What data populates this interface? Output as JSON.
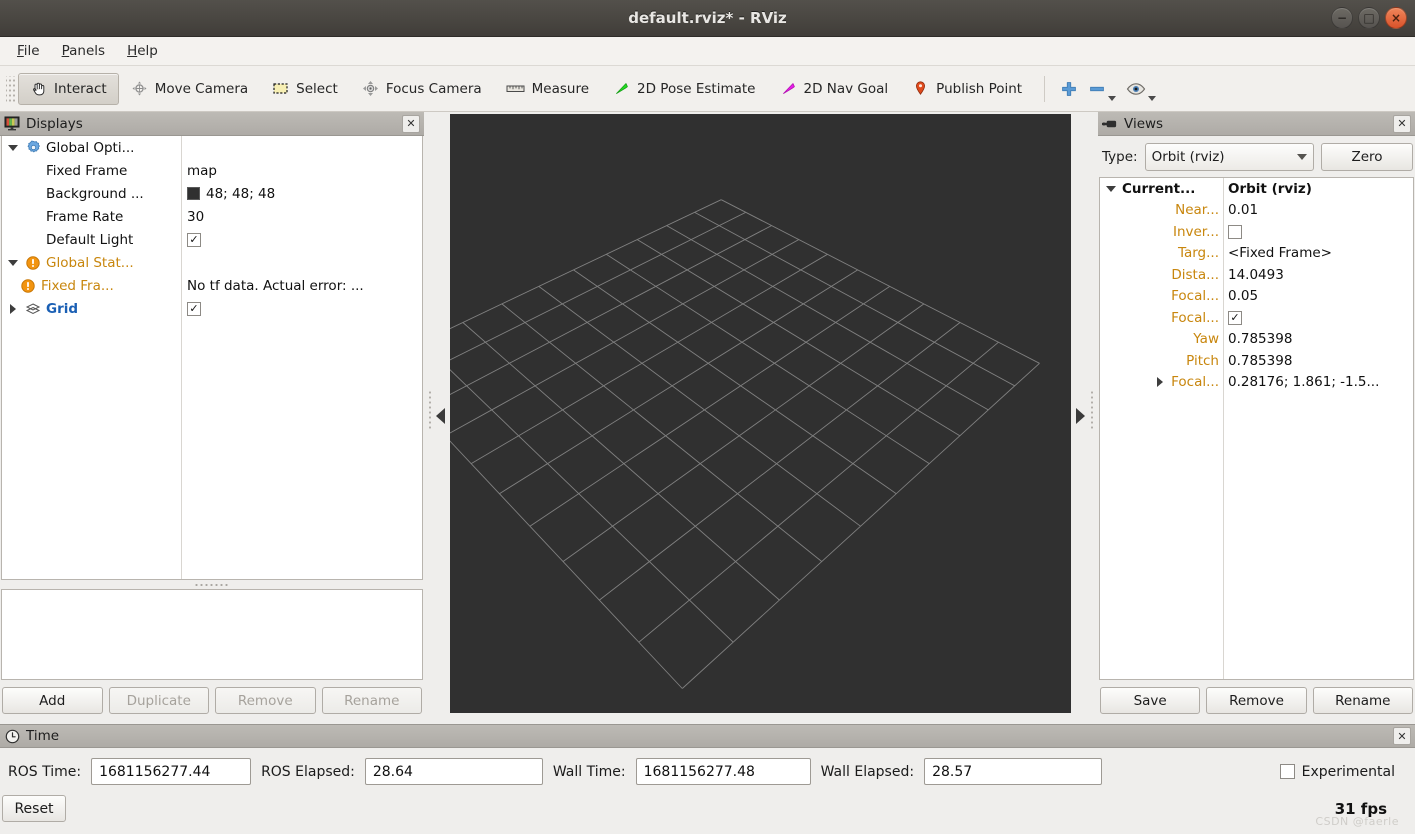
{
  "window": {
    "title": "default.rviz* - RViz",
    "buttons": {
      "minimize": "−",
      "maximize": "□",
      "close": "×"
    }
  },
  "menubar": {
    "items": [
      {
        "label": "File",
        "mnemonic": "F"
      },
      {
        "label": "Panels",
        "mnemonic": "P"
      },
      {
        "label": "Help",
        "mnemonic": "H"
      }
    ]
  },
  "toolbar": {
    "items": [
      {
        "label": "Interact",
        "icon": "hand-icon",
        "active": true
      },
      {
        "label": "Move Camera",
        "icon": "move-camera-icon",
        "active": false
      },
      {
        "label": "Select",
        "icon": "select-rect-icon",
        "active": false
      },
      {
        "label": "Focus Camera",
        "icon": "focus-camera-icon",
        "active": false
      },
      {
        "label": "Measure",
        "icon": "ruler-icon",
        "active": false
      },
      {
        "label": "2D Pose Estimate",
        "icon": "green-arrow-icon",
        "active": false
      },
      {
        "label": "2D Nav Goal",
        "icon": "magenta-arrow-icon",
        "active": false
      },
      {
        "label": "Publish Point",
        "icon": "map-pin-icon",
        "active": false
      }
    ],
    "extras": [
      {
        "icon": "plus-icon"
      },
      {
        "icon": "minus-icon"
      },
      {
        "icon": "eye-icon"
      }
    ]
  },
  "displays": {
    "header": {
      "title": "Displays",
      "icon": "monitor-color-icon",
      "close": "✕"
    },
    "rows": [
      {
        "twisty": "down",
        "icon": "gear-icon",
        "name": "Global Opti...",
        "style": "plain",
        "value_type": "none",
        "value": ""
      },
      {
        "twisty": "none",
        "icon": "none",
        "name": "Fixed Frame",
        "style": "plain",
        "value_type": "text",
        "value": "map",
        "indent": 1
      },
      {
        "twisty": "none",
        "icon": "none",
        "name": "Background ...",
        "style": "plain",
        "value_type": "swatch",
        "value": "48; 48; 48",
        "swatch_color": "#303030",
        "indent": 1
      },
      {
        "twisty": "none",
        "icon": "none",
        "name": "Frame Rate",
        "style": "plain",
        "value_type": "text",
        "value": "30",
        "indent": 1
      },
      {
        "twisty": "none",
        "icon": "none",
        "name": "Default Light",
        "style": "plain",
        "value_type": "checkbox",
        "value": "✓",
        "indent": 1
      },
      {
        "twisty": "down",
        "icon": "warning-icon",
        "name": "Global Stat...",
        "style": "warn",
        "value_type": "none",
        "value": ""
      },
      {
        "twisty": "none",
        "icon": "warning-icon",
        "name": "Fixed Fra...",
        "style": "warn",
        "value_type": "text",
        "value": "No tf data.  Actual error: ...",
        "indent": 1
      },
      {
        "twisty": "right",
        "icon": "grid-icon",
        "name": "Grid",
        "style": "link",
        "value_type": "checkbox",
        "value": "✓"
      }
    ],
    "buttons": [
      {
        "label": "Add",
        "enabled": true
      },
      {
        "label": "Duplicate",
        "enabled": false
      },
      {
        "label": "Remove",
        "enabled": false
      },
      {
        "label": "Rename",
        "enabled": false
      }
    ]
  },
  "views": {
    "header": {
      "title": "Views",
      "icon": "camera-icon",
      "close": "✕"
    },
    "type_label": "Type:",
    "type_value": "Orbit (rviz)",
    "zero_label": "Zero",
    "rows": [
      {
        "twisty": "down",
        "name": "Current...",
        "value": "Orbit (rviz)",
        "root": true,
        "value_type": "text"
      },
      {
        "twisty": "none",
        "name": "Near...",
        "value": "0.01",
        "root": false,
        "value_type": "text"
      },
      {
        "twisty": "none",
        "name": "Inver...",
        "value": "",
        "root": false,
        "value_type": "checkbox_empty"
      },
      {
        "twisty": "none",
        "name": "Targ...",
        "value": "<Fixed Frame>",
        "root": false,
        "value_type": "text"
      },
      {
        "twisty": "none",
        "name": "Dista...",
        "value": "14.0493",
        "root": false,
        "value_type": "text"
      },
      {
        "twisty": "none",
        "name": "Focal...",
        "value": "0.05",
        "root": false,
        "value_type": "text"
      },
      {
        "twisty": "none",
        "name": "Focal...",
        "value": "✓",
        "root": false,
        "value_type": "checkbox"
      },
      {
        "twisty": "none",
        "name": "Yaw",
        "value": "0.785398",
        "root": false,
        "value_type": "text"
      },
      {
        "twisty": "none",
        "name": "Pitch",
        "value": "0.785398",
        "root": false,
        "value_type": "text"
      },
      {
        "twisty": "right",
        "name": "Focal...",
        "value": "0.28176; 1.861; -1.5...",
        "root": false,
        "value_type": "text"
      }
    ],
    "buttons": [
      {
        "label": "Save",
        "enabled": true
      },
      {
        "label": "Remove",
        "enabled": true
      },
      {
        "label": "Rename",
        "enabled": true
      }
    ]
  },
  "time": {
    "header": {
      "title": "Time",
      "icon": "clock-icon",
      "close": "✕"
    },
    "fields": [
      {
        "label": "ROS Time:",
        "value": "1681156277.44"
      },
      {
        "label": "ROS Elapsed:",
        "value": "28.64"
      },
      {
        "label": "Wall Time:",
        "value": "1681156277.48"
      },
      {
        "label": "Wall Elapsed:",
        "value": "28.57"
      }
    ],
    "experimental_label": "Experimental",
    "reset_label": "Reset",
    "fps": "31 fps",
    "watermark": "CSDN @faerle"
  },
  "viewport": {
    "background_color": "#303030",
    "grid_line_color": "#9b9b9b",
    "grid_cells": 10
  }
}
